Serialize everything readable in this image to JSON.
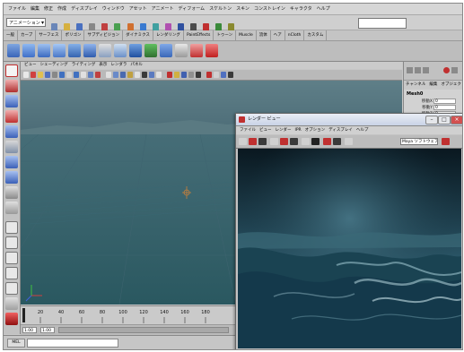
{
  "menubar": {
    "items": [
      "ファイル",
      "編集",
      "修正",
      "作成",
      "ディスプレイ",
      "ウィンドウ",
      "アセット",
      "アニメート",
      "ディフォーム",
      "スケルトン",
      "スキン",
      "コンストレイン",
      "キャラクタ",
      "ヘルプ"
    ]
  },
  "status": {
    "mode_value": "アニメーション"
  },
  "shelf": {
    "tabs": [
      "一般",
      "カーブ",
      "サーフェス",
      "ポリゴン",
      "サブディビジョン",
      "ダイナミクス",
      "レンダリング",
      "PaintEffects",
      "トゥーン",
      "Muscle",
      "流体",
      "ヘア",
      "nCloth",
      "カスタム"
    ]
  },
  "viewport": {
    "menu": [
      "ビュー",
      "シェーディング",
      "ライティング",
      "表示",
      "レンダラ",
      "パネル"
    ]
  },
  "timeline": {
    "ticks": [
      "20",
      "40",
      "60",
      "80",
      "100",
      "120",
      "140",
      "160",
      "180"
    ],
    "range_start": "1.00",
    "range_end": "1.00"
  },
  "mel": {
    "label": "MEL"
  },
  "channel_box": {
    "tabs": [
      "チャンネル",
      "編集",
      "オブジェクト"
    ],
    "object_name": "Mesh0",
    "attributes": [
      {
        "name": "移動X",
        "value": "0"
      },
      {
        "name": "移動Y",
        "value": "0"
      },
      {
        "name": "移動Z",
        "value": "0"
      },
      {
        "name": "回転X",
        "value": "0"
      },
      {
        "name": "回転Y",
        "value": "0"
      },
      {
        "name": "回転Z",
        "value": "0"
      }
    ]
  },
  "render_view": {
    "title": "レンダー ビュー",
    "menu": [
      "ファイル",
      "ビュー",
      "レンダー",
      "IPR",
      "オプション",
      "ディスプレイ",
      "ヘルプ"
    ],
    "camera_select": "Maya ソフトウェア",
    "minimize": "–",
    "maximize": "□",
    "close": "×"
  },
  "colors": {
    "accent_red": "#c03030",
    "viewport_top": "#5f7f88",
    "viewport_bottom": "#2f5960"
  }
}
